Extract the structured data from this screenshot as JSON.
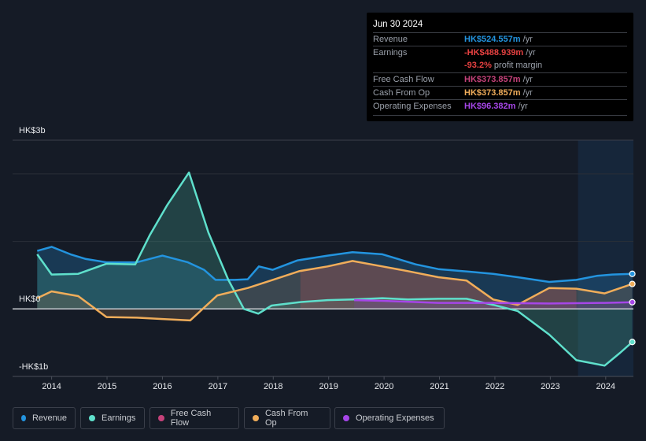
{
  "tooltip": {
    "date": "Jun 30 2024",
    "rows": [
      {
        "label": "Revenue",
        "value": "HK$524.557m",
        "unit": "/yr",
        "color": "#2394df"
      },
      {
        "label": "Earnings",
        "value": "-HK$488.939m",
        "unit": "/yr",
        "color": "#e64141"
      },
      {
        "label": "",
        "value": "-93.2%",
        "unit": "profit margin",
        "color": "#e64141"
      },
      {
        "label": "Free Cash Flow",
        "value": "HK$373.857m",
        "unit": "/yr",
        "color": "#c5427a"
      },
      {
        "label": "Cash From Op",
        "value": "HK$373.857m",
        "unit": "/yr",
        "color": "#f0ad5a"
      },
      {
        "label": "Operating Expenses",
        "value": "HK$96.382m",
        "unit": "/yr",
        "color": "#a646e8"
      }
    ]
  },
  "legend": [
    {
      "label": "Revenue",
      "color": "#2394df"
    },
    {
      "label": "Earnings",
      "color": "#5fe0cc"
    },
    {
      "label": "Free Cash Flow",
      "color": "#c5427a"
    },
    {
      "label": "Cash From Op",
      "color": "#f0ad5a"
    },
    {
      "label": "Operating Expenses",
      "color": "#a646e8"
    }
  ],
  "chart_data": {
    "type": "line",
    "title": "",
    "xlabel": "",
    "ylabel": "",
    "y_tick_labels": [
      "HK$3b",
      "HK$0",
      "-HK$1b"
    ],
    "x_tick_labels": [
      "2014",
      "2015",
      "2016",
      "2017",
      "2018",
      "2019",
      "2020",
      "2021",
      "2022",
      "2023",
      "2024"
    ],
    "xlim": [
      2013.75,
      2024.5
    ],
    "ylim": [
      -1.0,
      2.5
    ],
    "y_units": "HK$ billions",
    "grid": true,
    "forecast_shade_start": 2023.5,
    "legend_position": "bottom",
    "series": [
      {
        "name": "Revenue",
        "color": "#2394df",
        "x": [
          2013.74,
          2014.0,
          2014.34,
          2014.62,
          2014.99,
          2015.54,
          2016.0,
          2016.46,
          2016.75,
          2016.96,
          2017.31,
          2017.54,
          2017.74,
          2017.99,
          2018.44,
          2018.98,
          2019.43,
          2019.97,
          2020.57,
          2020.98,
          2021.56,
          2021.97,
          2022.41,
          2022.98,
          2023.47,
          2023.84,
          2024.12,
          2024.48
        ],
        "y": [
          0.86,
          0.92,
          0.81,
          0.74,
          0.69,
          0.69,
          0.79,
          0.69,
          0.58,
          0.43,
          0.43,
          0.44,
          0.63,
          0.58,
          0.72,
          0.79,
          0.84,
          0.81,
          0.66,
          0.59,
          0.55,
          0.52,
          0.47,
          0.4,
          0.43,
          0.49,
          0.51,
          0.52
        ]
      },
      {
        "name": "Earnings",
        "color": "#5fe0cc",
        "x": [
          2013.74,
          2014.0,
          2014.48,
          2014.99,
          2015.51,
          2015.77,
          2016.08,
          2016.48,
          2016.83,
          2017.19,
          2017.47,
          2017.73,
          2017.97,
          2018.47,
          2018.98,
          2019.43,
          2019.97,
          2020.43,
          2020.98,
          2021.49,
          2021.97,
          2022.41,
          2022.98,
          2023.47,
          2023.98,
          2024.26,
          2024.48
        ],
        "y": [
          0.81,
          0.51,
          0.52,
          0.67,
          0.66,
          1.09,
          1.53,
          2.02,
          1.13,
          0.43,
          0.0,
          -0.07,
          0.05,
          0.1,
          0.13,
          0.14,
          0.16,
          0.14,
          0.15,
          0.15,
          0.06,
          -0.03,
          -0.38,
          -0.76,
          -0.84,
          -0.65,
          -0.49
        ]
      },
      {
        "name": "Free Cash Flow",
        "color": "#c5427a",
        "x": [
          2018.49,
          2018.98,
          2019.43,
          2019.97,
          2020.43,
          2020.98,
          2021.49,
          2021.97,
          2022.41,
          2022.98,
          2023.47
        ],
        "y": [
          0.56,
          0.63,
          0.71,
          0.63,
          0.56,
          0.47,
          0.42,
          0.14,
          0.06,
          0.31,
          0.3
        ]
      },
      {
        "name": "Cash From Op",
        "color": "#f0ad5a",
        "x": [
          2013.74,
          2014.0,
          2014.48,
          2014.99,
          2015.54,
          2016.0,
          2016.5,
          2016.99,
          2017.54,
          2017.99,
          2018.47,
          2018.98,
          2019.43,
          2019.97,
          2020.43,
          2020.98,
          2021.49,
          2021.97,
          2022.41,
          2022.98,
          2023.47,
          2023.98,
          2024.48
        ],
        "y": [
          0.16,
          0.26,
          0.19,
          -0.12,
          -0.13,
          -0.15,
          -0.17,
          0.2,
          0.31,
          0.43,
          0.56,
          0.63,
          0.71,
          0.63,
          0.56,
          0.47,
          0.42,
          0.14,
          0.06,
          0.31,
          0.3,
          0.23,
          0.37
        ]
      },
      {
        "name": "Operating Expenses",
        "color": "#a646e8",
        "x": [
          2019.46,
          2019.97,
          2020.98,
          2021.97,
          2022.98,
          2023.98,
          2024.48
        ],
        "y": [
          0.13,
          0.12,
          0.09,
          0.09,
          0.08,
          0.09,
          0.1
        ]
      }
    ]
  }
}
